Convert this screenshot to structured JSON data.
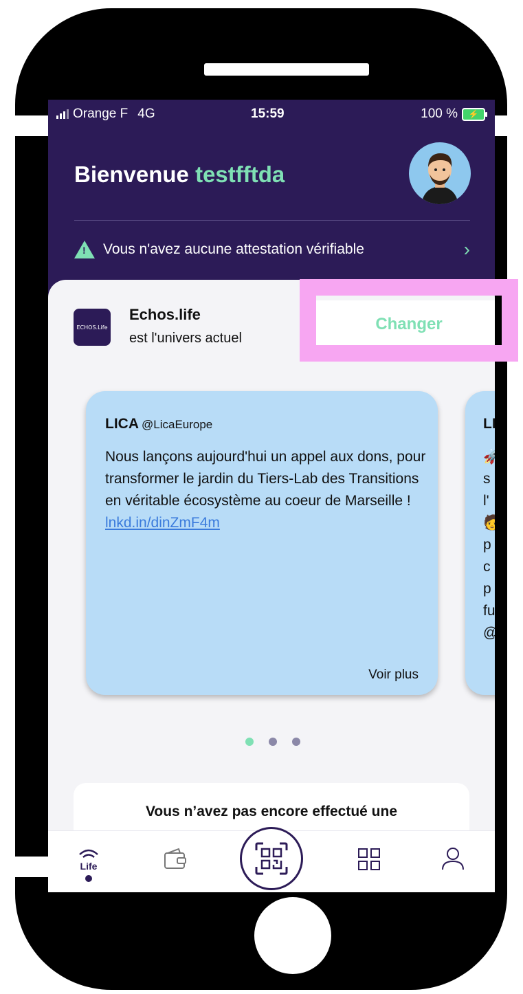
{
  "status_bar": {
    "carrier": "Orange F",
    "network": "4G",
    "time": "15:59",
    "battery": "100 %"
  },
  "header": {
    "greeting": "Bienvenue",
    "username": "testfftda",
    "attestation_notice": "Vous n'avez aucune attestation vérifiable"
  },
  "universe": {
    "logo_text": "ECHOS.Life",
    "name": "Echos.life",
    "subtitle": "est l'univers actuel",
    "change_label": "Changer"
  },
  "cards": [
    {
      "author": "LICA",
      "handle": "@LicaEurope",
      "text": "Nous lançons aujourd'hui un appel aux dons, pour transformer le jardin du Tiers-Lab des Transitions en véritable écosystème au coeur de Marseille !",
      "link": "lnkd.in/dinZmF4m",
      "more_label": "Voir plus"
    },
    {
      "author": "LI",
      "text_fragments": [
        "s",
        "l'",
        "p",
        "c",
        "p",
        "fu",
        "@"
      ]
    }
  ],
  "carousel": {
    "count": 3,
    "active": 0
  },
  "notice": {
    "text": "Vous n’avez pas encore effectué une"
  },
  "tabbar": {
    "life_label": "Life"
  },
  "colors": {
    "header_bg": "#2c1b57",
    "accent": "#7fe0b4",
    "card_bg": "#b8dcf7",
    "highlight": "#f7a6f2"
  }
}
